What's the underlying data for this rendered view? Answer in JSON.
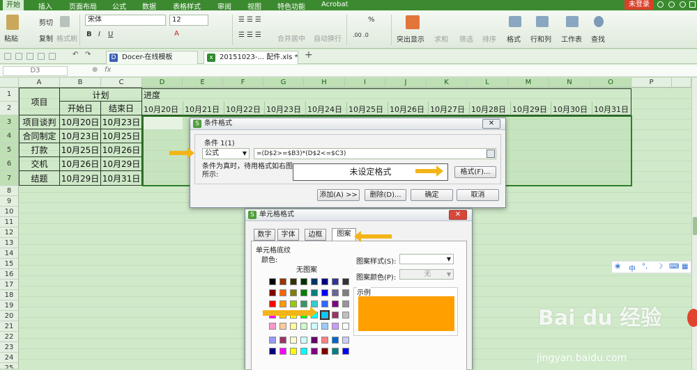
{
  "menu": [
    "开始",
    "插入",
    "页面布局",
    "公式",
    "数据",
    "表格样式",
    "审阅",
    "视图",
    "特色功能",
    "Acrobat"
  ],
  "login": "未登录",
  "ribbon": {
    "paste": "粘贴",
    "cut": "剪切",
    "copy": "复制",
    "format_painter": "格式刷",
    "font": "宋体",
    "size": "12",
    "merge": "合并居中",
    "wrap": "自动换行",
    "percent": "%",
    "cond_format": "突出显示",
    "sum": "求和",
    "filter": "筛选",
    "sort": "排序",
    "format": "格式",
    "rowcol": "行和列",
    "worksheet": "工作表",
    "find": "查找"
  },
  "tabs": {
    "tab1": "Docer-在线模板",
    "tab2": "20151023-... 配件.xls *"
  },
  "namebox": "D3",
  "fx": "fx",
  "columns": [
    "A",
    "B",
    "C",
    "D",
    "E",
    "F",
    "G",
    "H",
    "I",
    "J",
    "K",
    "L",
    "M",
    "N",
    "O",
    "P"
  ],
  "rows": [
    "1",
    "2",
    "3",
    "4",
    "5",
    "6",
    "7",
    "8",
    "9",
    "10",
    "11",
    "12",
    "13",
    "14",
    "15",
    "16",
    "17",
    "18",
    "19",
    "20",
    "21",
    "22",
    "23",
    "24",
    "25"
  ],
  "sheet": {
    "header_project": "项目",
    "header_plan": "计划",
    "header_start": "开始日",
    "header_end": "结束日",
    "header_progress": "进度",
    "dates": [
      "10月20日",
      "10月21日",
      "10月22日",
      "10月23日",
      "10月24日",
      "10月25日",
      "10月26日",
      "10月27日",
      "10月28日",
      "10月29日",
      "10月30日",
      "10月31日"
    ],
    "tasks": [
      {
        "name": "项目谈判",
        "start": "10月20日",
        "end": "10月23日"
      },
      {
        "name": "合同制定",
        "start": "10月23日",
        "end": "10月25日"
      },
      {
        "name": "打款",
        "start": "10月25日",
        "end": "10月26日"
      },
      {
        "name": "交机",
        "start": "10月26日",
        "end": "10月29日"
      },
      {
        "name": "结题",
        "start": "10月29日",
        "end": "10月31日"
      }
    ]
  },
  "cond_dialog": {
    "title": "条件格式",
    "cond_label": "条件 1(1)",
    "type": "公式",
    "formula": "=(D$2>=$B3)*(D$2<=$C3)",
    "preview_label": "条件为真时，待用格式如右图所示:",
    "preview_text": "未设定格式",
    "format_btn": "格式(F)...",
    "add_btn": "添加(A) >>",
    "delete_btn": "删除(D)...",
    "ok_btn": "确定",
    "cancel_btn": "取消"
  },
  "cell_dialog": {
    "title": "单元格格式",
    "tabs": [
      "数字",
      "字体",
      "边框",
      "图案"
    ],
    "section": "单元格底纹",
    "color_label": "颜色:",
    "no_pattern": "无图案",
    "pattern_style": "图案样式(S):",
    "pattern_color": "图案颜色(P):",
    "pattern_color_value": "无",
    "sample": "示例",
    "sample_color": "#ff9f00"
  },
  "ime": [
    "中",
    "°,"
  ],
  "watermark": {
    "logo": "Bai du 经验",
    "url": "jingyan.baidu.com"
  }
}
